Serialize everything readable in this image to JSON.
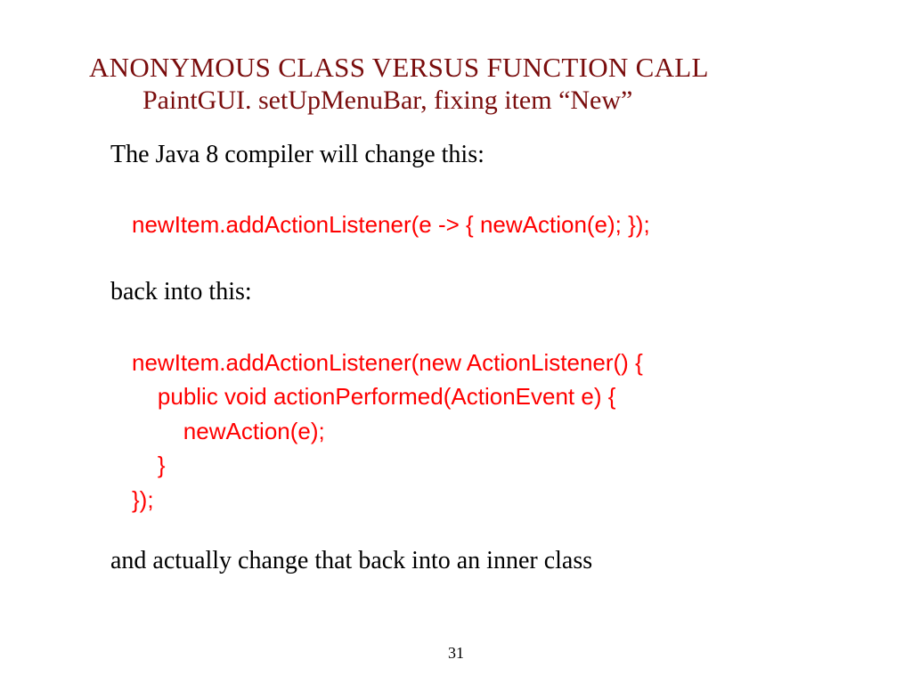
{
  "slide": {
    "title1": "ANONYMOUS CLASS VERSUS FUNCTION CALL",
    "title2": "PaintGUI. setUpMenuBar, fixing item “New”",
    "intro": "The Java 8 compiler  will change this:",
    "code1": "newItem.addActionListener(e -> { newAction(e); });",
    "middle": "back into this:",
    "code2": "newItem.addActionListener(new ActionListener() {\n    public void actionPerformed(ActionEvent e) {\n        newAction(e);\n    }\n});",
    "outro": "and actually change that back into an inner class",
    "page_number": "31"
  }
}
